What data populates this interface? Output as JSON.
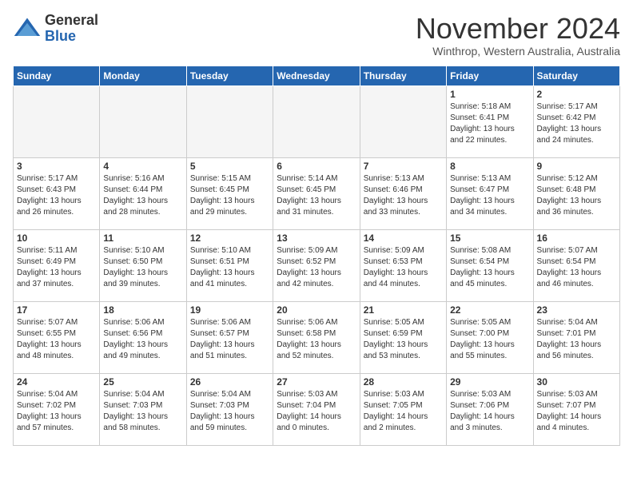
{
  "logo": {
    "general": "General",
    "blue": "Blue"
  },
  "title": "November 2024",
  "location": "Winthrop, Western Australia, Australia",
  "weekdays": [
    "Sunday",
    "Monday",
    "Tuesday",
    "Wednesday",
    "Thursday",
    "Friday",
    "Saturday"
  ],
  "weeks": [
    [
      {
        "day": "",
        "info": "",
        "empty": true
      },
      {
        "day": "",
        "info": "",
        "empty": true
      },
      {
        "day": "",
        "info": "",
        "empty": true
      },
      {
        "day": "",
        "info": "",
        "empty": true
      },
      {
        "day": "",
        "info": "",
        "empty": true
      },
      {
        "day": "1",
        "info": "Sunrise: 5:18 AM\nSunset: 6:41 PM\nDaylight: 13 hours\nand 22 minutes.",
        "empty": false
      },
      {
        "day": "2",
        "info": "Sunrise: 5:17 AM\nSunset: 6:42 PM\nDaylight: 13 hours\nand 24 minutes.",
        "empty": false
      }
    ],
    [
      {
        "day": "3",
        "info": "Sunrise: 5:17 AM\nSunset: 6:43 PM\nDaylight: 13 hours\nand 26 minutes.",
        "empty": false
      },
      {
        "day": "4",
        "info": "Sunrise: 5:16 AM\nSunset: 6:44 PM\nDaylight: 13 hours\nand 28 minutes.",
        "empty": false
      },
      {
        "day": "5",
        "info": "Sunrise: 5:15 AM\nSunset: 6:45 PM\nDaylight: 13 hours\nand 29 minutes.",
        "empty": false
      },
      {
        "day": "6",
        "info": "Sunrise: 5:14 AM\nSunset: 6:45 PM\nDaylight: 13 hours\nand 31 minutes.",
        "empty": false
      },
      {
        "day": "7",
        "info": "Sunrise: 5:13 AM\nSunset: 6:46 PM\nDaylight: 13 hours\nand 33 minutes.",
        "empty": false
      },
      {
        "day": "8",
        "info": "Sunrise: 5:13 AM\nSunset: 6:47 PM\nDaylight: 13 hours\nand 34 minutes.",
        "empty": false
      },
      {
        "day": "9",
        "info": "Sunrise: 5:12 AM\nSunset: 6:48 PM\nDaylight: 13 hours\nand 36 minutes.",
        "empty": false
      }
    ],
    [
      {
        "day": "10",
        "info": "Sunrise: 5:11 AM\nSunset: 6:49 PM\nDaylight: 13 hours\nand 37 minutes.",
        "empty": false
      },
      {
        "day": "11",
        "info": "Sunrise: 5:10 AM\nSunset: 6:50 PM\nDaylight: 13 hours\nand 39 minutes.",
        "empty": false
      },
      {
        "day": "12",
        "info": "Sunrise: 5:10 AM\nSunset: 6:51 PM\nDaylight: 13 hours\nand 41 minutes.",
        "empty": false
      },
      {
        "day": "13",
        "info": "Sunrise: 5:09 AM\nSunset: 6:52 PM\nDaylight: 13 hours\nand 42 minutes.",
        "empty": false
      },
      {
        "day": "14",
        "info": "Sunrise: 5:09 AM\nSunset: 6:53 PM\nDaylight: 13 hours\nand 44 minutes.",
        "empty": false
      },
      {
        "day": "15",
        "info": "Sunrise: 5:08 AM\nSunset: 6:54 PM\nDaylight: 13 hours\nand 45 minutes.",
        "empty": false
      },
      {
        "day": "16",
        "info": "Sunrise: 5:07 AM\nSunset: 6:54 PM\nDaylight: 13 hours\nand 46 minutes.",
        "empty": false
      }
    ],
    [
      {
        "day": "17",
        "info": "Sunrise: 5:07 AM\nSunset: 6:55 PM\nDaylight: 13 hours\nand 48 minutes.",
        "empty": false
      },
      {
        "day": "18",
        "info": "Sunrise: 5:06 AM\nSunset: 6:56 PM\nDaylight: 13 hours\nand 49 minutes.",
        "empty": false
      },
      {
        "day": "19",
        "info": "Sunrise: 5:06 AM\nSunset: 6:57 PM\nDaylight: 13 hours\nand 51 minutes.",
        "empty": false
      },
      {
        "day": "20",
        "info": "Sunrise: 5:06 AM\nSunset: 6:58 PM\nDaylight: 13 hours\nand 52 minutes.",
        "empty": false
      },
      {
        "day": "21",
        "info": "Sunrise: 5:05 AM\nSunset: 6:59 PM\nDaylight: 13 hours\nand 53 minutes.",
        "empty": false
      },
      {
        "day": "22",
        "info": "Sunrise: 5:05 AM\nSunset: 7:00 PM\nDaylight: 13 hours\nand 55 minutes.",
        "empty": false
      },
      {
        "day": "23",
        "info": "Sunrise: 5:04 AM\nSunset: 7:01 PM\nDaylight: 13 hours\nand 56 minutes.",
        "empty": false
      }
    ],
    [
      {
        "day": "24",
        "info": "Sunrise: 5:04 AM\nSunset: 7:02 PM\nDaylight: 13 hours\nand 57 minutes.",
        "empty": false
      },
      {
        "day": "25",
        "info": "Sunrise: 5:04 AM\nSunset: 7:03 PM\nDaylight: 13 hours\nand 58 minutes.",
        "empty": false
      },
      {
        "day": "26",
        "info": "Sunrise: 5:04 AM\nSunset: 7:03 PM\nDaylight: 13 hours\nand 59 minutes.",
        "empty": false
      },
      {
        "day": "27",
        "info": "Sunrise: 5:03 AM\nSunset: 7:04 PM\nDaylight: 14 hours\nand 0 minutes.",
        "empty": false
      },
      {
        "day": "28",
        "info": "Sunrise: 5:03 AM\nSunset: 7:05 PM\nDaylight: 14 hours\nand 2 minutes.",
        "empty": false
      },
      {
        "day": "29",
        "info": "Sunrise: 5:03 AM\nSunset: 7:06 PM\nDaylight: 14 hours\nand 3 minutes.",
        "empty": false
      },
      {
        "day": "30",
        "info": "Sunrise: 5:03 AM\nSunset: 7:07 PM\nDaylight: 14 hours\nand 4 minutes.",
        "empty": false
      }
    ]
  ]
}
